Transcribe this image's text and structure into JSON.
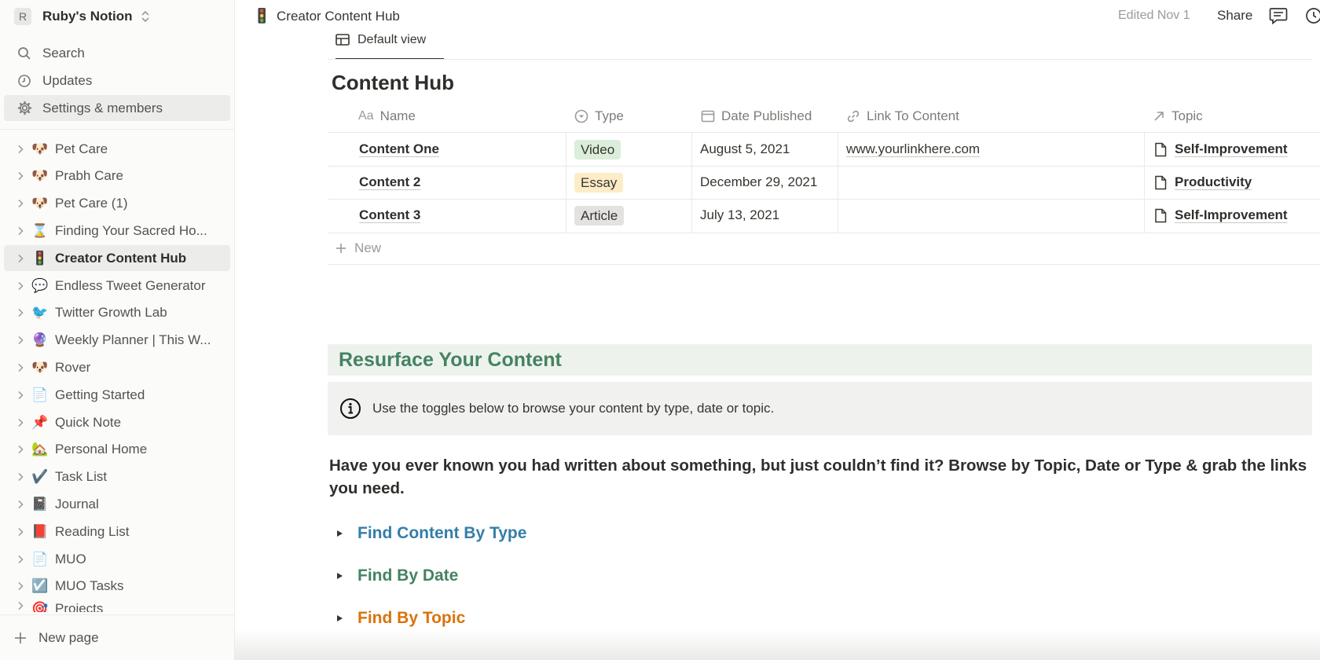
{
  "workspace": {
    "initial": "R",
    "name": "Ruby's Notion"
  },
  "sidebar": {
    "nav": [
      {
        "label": "Search",
        "icon": "search-icon"
      },
      {
        "label": "Updates",
        "icon": "clock-icon"
      },
      {
        "label": "Settings & members",
        "icon": "gear-icon"
      }
    ],
    "pages": [
      {
        "emoji": "🐶",
        "label": "Pet Care"
      },
      {
        "emoji": "🐶",
        "label": "Prabh Care"
      },
      {
        "emoji": "🐶",
        "label": "Pet Care (1)"
      },
      {
        "emoji": "⌛",
        "label": "Finding Your Sacred Ho..."
      },
      {
        "emoji": "🚦",
        "label": "Creator Content Hub"
      },
      {
        "emoji": "💬",
        "label": "Endless Tweet Generator"
      },
      {
        "emoji": "🐦",
        "label": "Twitter Growth Lab"
      },
      {
        "emoji": "🔮",
        "label": "Weekly Planner | This W..."
      },
      {
        "emoji": "🐶",
        "label": "Rover"
      },
      {
        "emoji": "📄",
        "label": "Getting Started"
      },
      {
        "emoji": "📌",
        "label": "Quick Note"
      },
      {
        "emoji": "🏡",
        "label": "Personal Home"
      },
      {
        "emoji": "✔️",
        "label": "Task List"
      },
      {
        "emoji": "📓",
        "label": "Journal"
      },
      {
        "emoji": "📕",
        "label": "Reading List"
      },
      {
        "emoji": "📄",
        "label": "MUO"
      },
      {
        "emoji": "☑️",
        "label": "MUO Tasks"
      },
      {
        "emoji": "🎯",
        "label": "Projects"
      }
    ],
    "new_page": "New page"
  },
  "topbar": {
    "emoji": "🚦",
    "title": "Creator Content Hub",
    "edited": "Edited Nov 1",
    "share": "Share"
  },
  "view_tab": "Default view",
  "database": {
    "title": "Content Hub",
    "columns": [
      {
        "label": "Name",
        "icon": "text-aa-icon"
      },
      {
        "label": "Type",
        "icon": "select-icon"
      },
      {
        "label": "Date Published",
        "icon": "calendar-icon"
      },
      {
        "label": "Link To Content",
        "icon": "link-icon"
      },
      {
        "label": "Topic",
        "icon": "relation-arrow-icon"
      }
    ],
    "rows": [
      {
        "name": "Content One",
        "type": "Video",
        "type_color": "#dbeddb",
        "date": "August 5, 2021",
        "link": "www.yourlinkhere.com",
        "topic": "Self-Improvement"
      },
      {
        "name": "Content 2",
        "type": "Essay",
        "type_color": "#fdecc8",
        "date": "December 29, 2021",
        "link": "",
        "topic": "Productivity"
      },
      {
        "name": "Content 3",
        "type": "Article",
        "type_color": "#e3e2e0",
        "date": "July 13, 2021",
        "link": "",
        "topic": "Self-Improvement"
      }
    ],
    "new_label": "New"
  },
  "resurface": {
    "heading": "Resurface Your Content",
    "heading_bg": "#edf3ec",
    "callout": "Use the toggles below to browse your content by type, date or topic.",
    "paragraph": "Have you ever known you had written about something, but just couldn’t find it? Browse by Topic, Date or Type & grab the links you need.",
    "toggles": [
      {
        "label": "Find Content By Type",
        "color": "#337ea9"
      },
      {
        "label": "Find By Date",
        "color": "#448361"
      },
      {
        "label": "Find By Topic",
        "color": "#d9730d"
      }
    ]
  }
}
